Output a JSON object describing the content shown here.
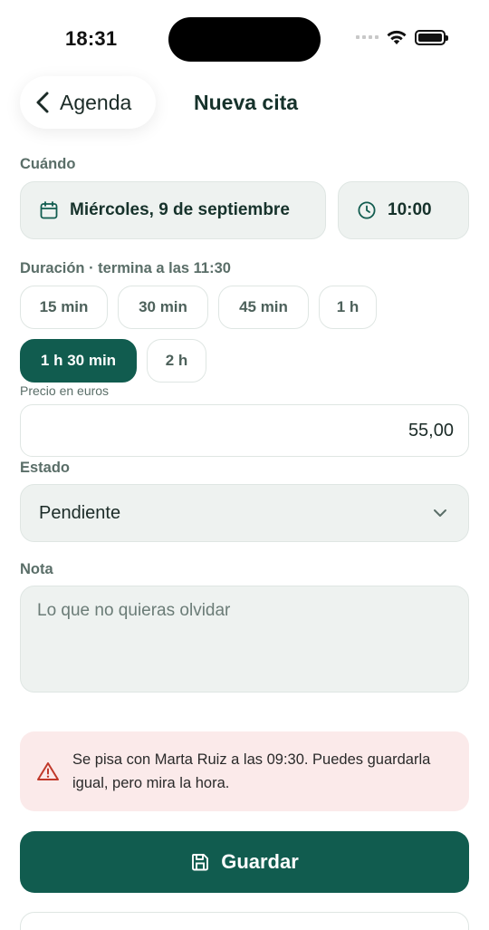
{
  "status_bar": {
    "time": "18:31"
  },
  "nav": {
    "back_label": "Agenda",
    "title": "Nueva cita"
  },
  "when": {
    "label": "Cuándo",
    "date": "Miércoles, 9 de septiembre",
    "time": "10:00"
  },
  "duration": {
    "label": "Duración · termina a las 11:30",
    "options": [
      "15 min",
      "30 min",
      "45 min",
      "1 h",
      "1 h 30 min",
      "2 h"
    ],
    "selected": "1 h 30 min"
  },
  "price": {
    "label": "Precio en euros",
    "value": "55,00"
  },
  "status": {
    "label": "Estado",
    "value": "Pendiente"
  },
  "note": {
    "label": "Nota",
    "placeholder": "Lo que no quieras olvidar"
  },
  "alert": {
    "text": "Se pisa con Marta Ruiz a las 09:30. Puedes guardarla igual, pero mira la hora."
  },
  "actions": {
    "save_label": "Guardar"
  },
  "colors": {
    "primary": "#115c4f",
    "field_bg": "#eef2f0",
    "alert_bg": "#fbeaea",
    "alert_icon": "#c0392b"
  },
  "icons": [
    "chevron-left-icon",
    "calendar-icon",
    "clock-icon",
    "chevron-down-icon",
    "warning-icon",
    "save-icon",
    "wifi-icon",
    "battery-icon",
    "signal-icon"
  ]
}
